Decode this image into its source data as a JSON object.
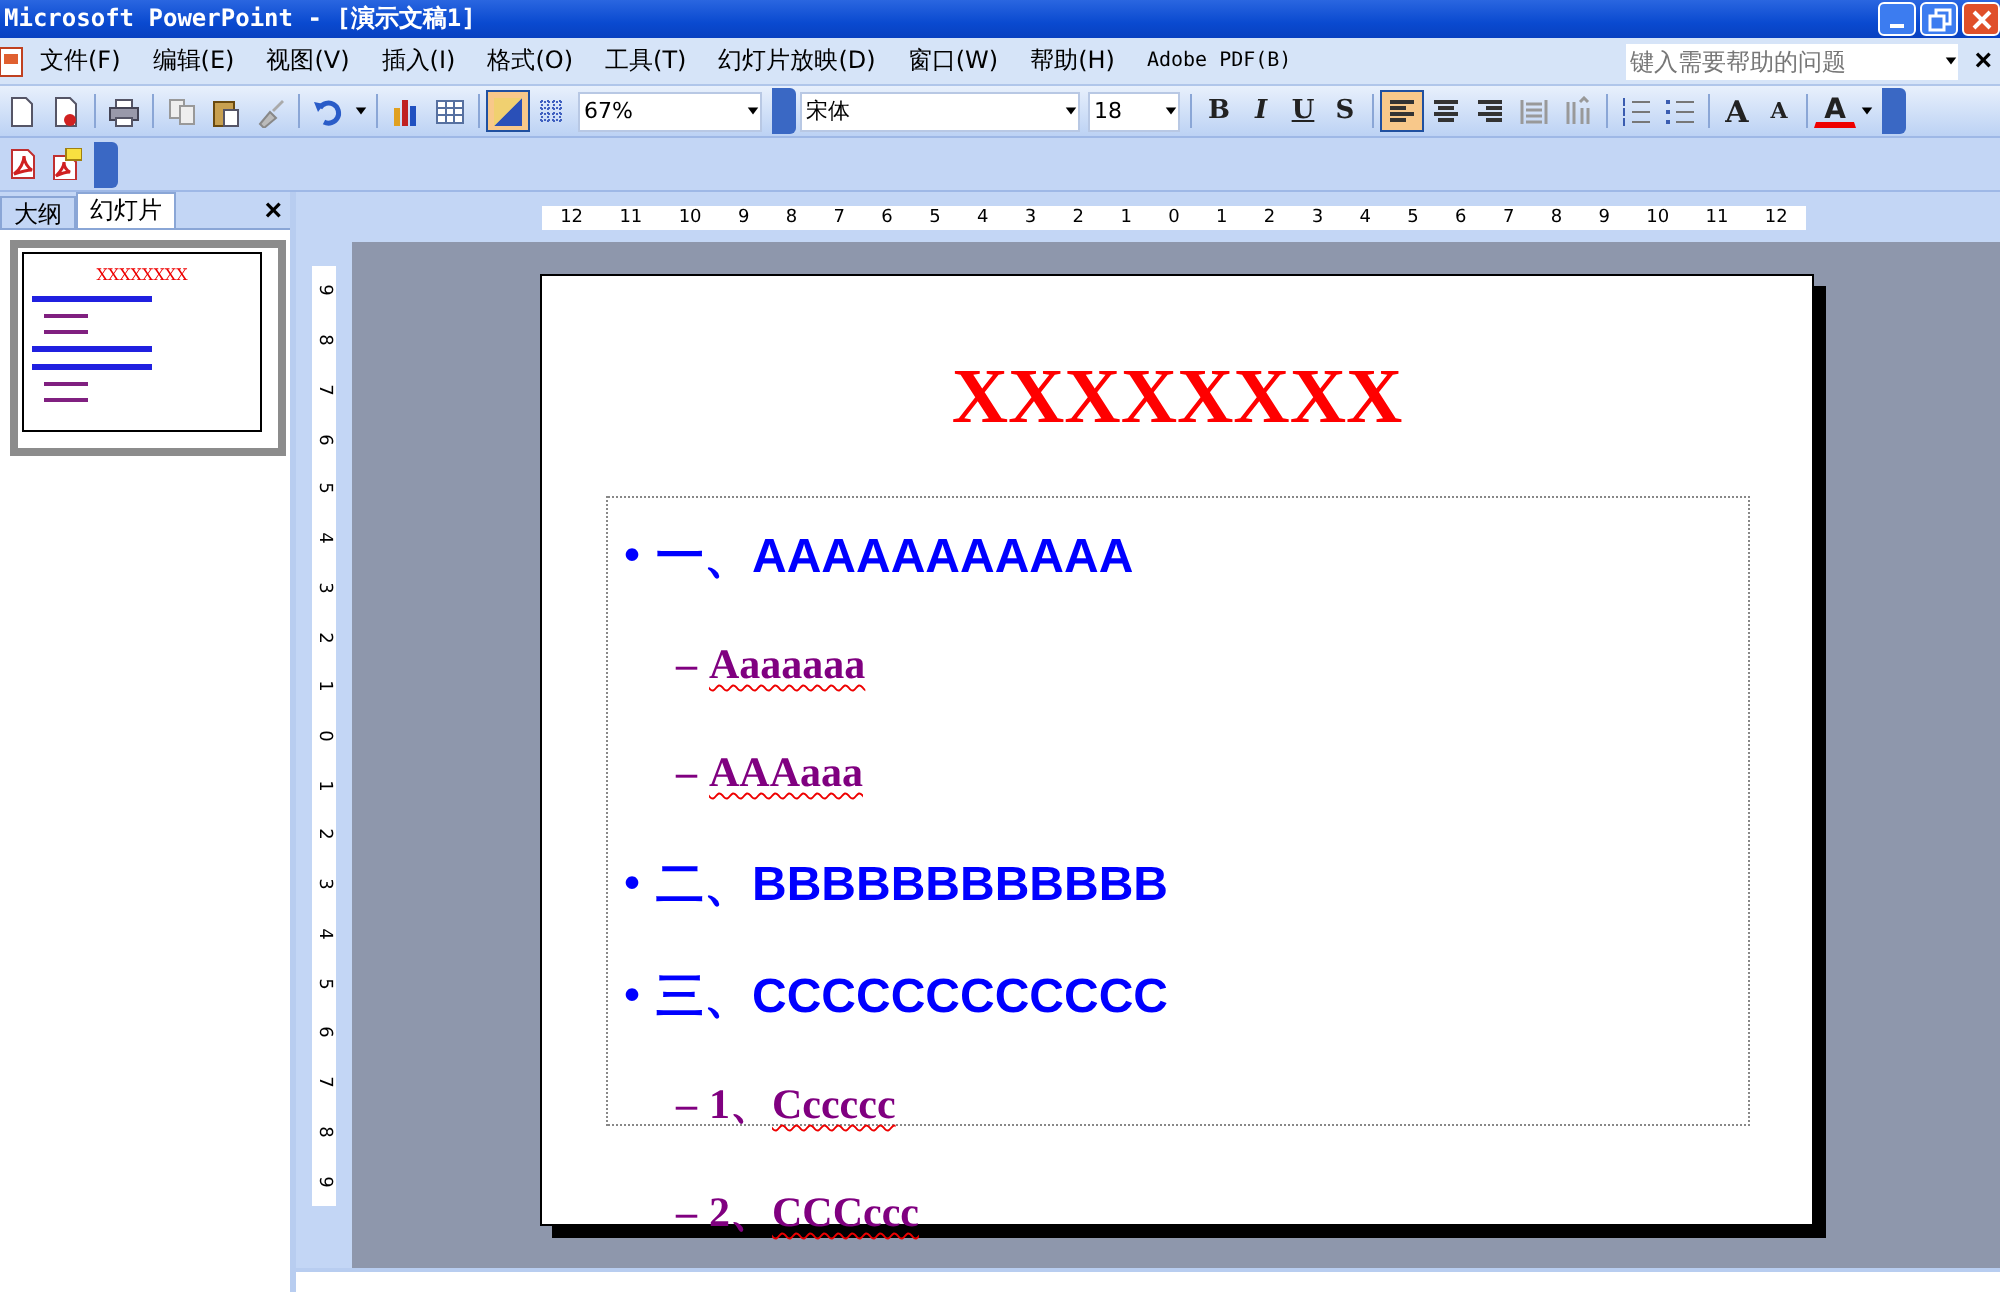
{
  "window": {
    "title": "Microsoft PowerPoint - [演示文稿1]"
  },
  "menu": [
    "文件(F)",
    "编辑(E)",
    "视图(V)",
    "插入(I)",
    "格式(O)",
    "工具(T)",
    "幻灯片放映(D)",
    "窗口(W)",
    "帮助(H)",
    "Adobe PDF(B)"
  ],
  "help_box": {
    "placeholder": "键入需要帮助的问题"
  },
  "menu_close": "×",
  "toolbar": [
    {
      "kind": "new",
      "pressed": false
    },
    {
      "kind": "pdfdoc",
      "pressed": false
    },
    {
      "kind": "sep"
    },
    {
      "kind": "print",
      "pressed": false
    },
    {
      "kind": "sep"
    },
    {
      "kind": "copy",
      "pressed": false
    },
    {
      "kind": "paste",
      "pressed": false
    },
    {
      "kind": "brush",
      "pressed": false
    },
    {
      "kind": "sep"
    },
    {
      "kind": "undo",
      "pressed": false
    },
    {
      "kind": "dropdown"
    },
    {
      "kind": "sep"
    },
    {
      "kind": "chart",
      "pressed": false
    },
    {
      "kind": "table",
      "pressed": false
    },
    {
      "kind": "sep"
    },
    {
      "kind": "gray",
      "pressed": true
    },
    {
      "kind": "grid",
      "pressed": false
    },
    {
      "kind": "zoom",
      "value": "67%"
    },
    {
      "kind": "grip"
    },
    {
      "kind": "font",
      "value": "宋体"
    },
    {
      "kind": "fontsize",
      "value": "18"
    },
    {
      "kind": "sep"
    },
    {
      "kind": "bold",
      "label": "B",
      "pressed": false
    },
    {
      "kind": "italic",
      "label": "I",
      "pressed": false
    },
    {
      "kind": "underline",
      "label": "U",
      "pressed": false
    },
    {
      "kind": "shadow",
      "label": "S",
      "pressed": false
    },
    {
      "kind": "sep"
    },
    {
      "kind": "alignleft",
      "pressed": true
    },
    {
      "kind": "aligncenter",
      "pressed": false
    },
    {
      "kind": "alignright",
      "pressed": false
    },
    {
      "kind": "distribute",
      "pressed": false
    },
    {
      "kind": "columns",
      "pressed": false
    },
    {
      "kind": "sep"
    },
    {
      "kind": "numbering",
      "pressed": false
    },
    {
      "kind": "bullets",
      "pressed": false
    },
    {
      "kind": "sep"
    },
    {
      "kind": "grow",
      "label": "A",
      "pressed": false
    },
    {
      "kind": "shrink",
      "label": "A",
      "pressed": false
    },
    {
      "kind": "sep"
    },
    {
      "kind": "fontcolor",
      "label": "A",
      "pressed": false
    },
    {
      "kind": "dropdown"
    },
    {
      "kind": "grip"
    }
  ],
  "toolbar2": [
    {
      "kind": "pdf",
      "pressed": false
    },
    {
      "kind": "pdfcomment",
      "pressed": false
    },
    {
      "kind": "grip"
    }
  ],
  "pane": {
    "tabs": [
      {
        "label": "大纲",
        "selected": false
      },
      {
        "label": "幻灯片",
        "selected": true
      }
    ],
    "close": "×",
    "thumbnail": {
      "title": "XXXXXXXX",
      "selected": true
    }
  },
  "ruler_h": [
    "12",
    "11",
    "10",
    "9",
    "8",
    "7",
    "6",
    "5",
    "4",
    "3",
    "2",
    "1",
    "0",
    "1",
    "2",
    "3",
    "4",
    "5",
    "6",
    "7",
    "8",
    "9",
    "10",
    "11",
    "12"
  ],
  "ruler_v": [
    "9",
    "8",
    "7",
    "6",
    "5",
    "4",
    "3",
    "2",
    "1",
    "0",
    "1",
    "2",
    "3",
    "4",
    "5",
    "6",
    "7",
    "8",
    "9"
  ],
  "slide": {
    "title": "XXXXXXXX",
    "bullets": [
      {
        "marker": "•",
        "text": "一、AAAAAAAAAAA",
        "children": [
          {
            "marker": "–",
            "text": "Aaaaaaa",
            "misspelled": true
          },
          {
            "marker": "–",
            "text": "AAAaaa",
            "misspelled": true
          }
        ]
      },
      {
        "marker": "•",
        "text": "二、BBBBBBBBBBBB"
      },
      {
        "marker": "•",
        "text": "三、CCCCCCCCCCCC",
        "children": [
          {
            "marker": "–",
            "number": "1、",
            "text": "Cccccc",
            "misspelled": true
          },
          {
            "marker": "–",
            "number": "2、",
            "text": "CCCccc",
            "misspelled": true
          }
        ]
      }
    ]
  }
}
